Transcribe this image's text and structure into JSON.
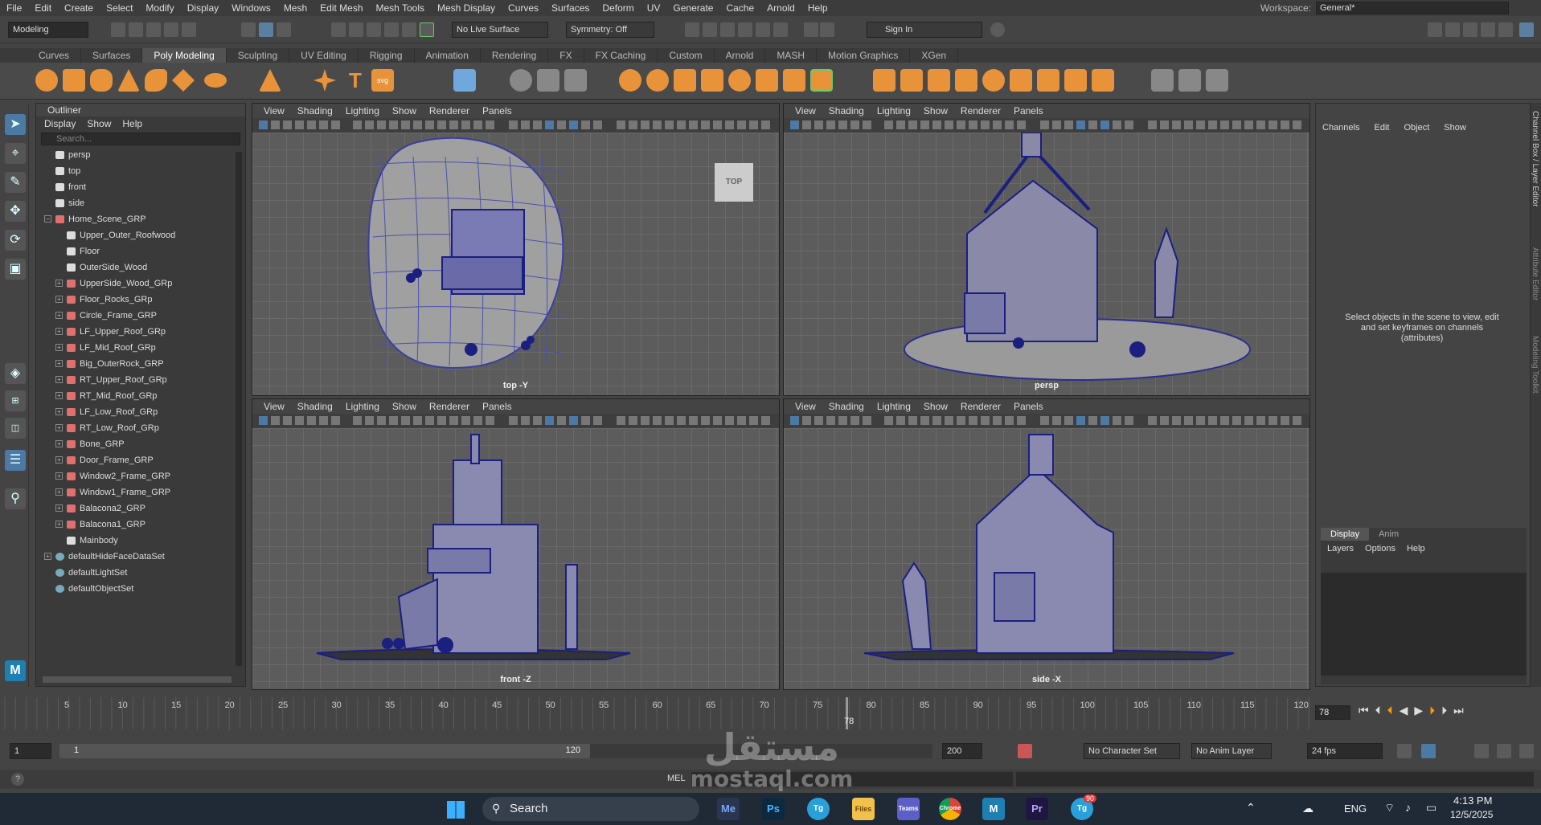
{
  "menubar": [
    "File",
    "Edit",
    "Create",
    "Select",
    "Modify",
    "Display",
    "Windows",
    "Mesh",
    "Edit Mesh",
    "Mesh Tools",
    "Mesh Display",
    "Curves",
    "Surfaces",
    "Deform",
    "UV",
    "Generate",
    "Cache",
    "Arnold",
    "Help"
  ],
  "workspace": {
    "label": "Workspace:",
    "value": "General*"
  },
  "status": {
    "mode": "Modeling",
    "live_surface": "No Live Surface",
    "symmetry": "Symmetry: Off",
    "sign_in": "Sign In"
  },
  "shelf_tabs": [
    "Curves",
    "Surfaces",
    "Poly Modeling",
    "Sculpting",
    "UV Editing",
    "Rigging",
    "Animation",
    "Rendering",
    "FX",
    "FX Caching",
    "Custom",
    "Arnold",
    "MASH",
    "Motion Graphics",
    "XGen"
  ],
  "outliner": {
    "title": "Outliner",
    "menu": [
      "Display",
      "Show",
      "Help"
    ],
    "search_placeholder": "Search...",
    "items": [
      {
        "label": "persp",
        "indent": 0,
        "icon": "camera-icon",
        "expander": ""
      },
      {
        "label": "top",
        "indent": 0,
        "icon": "camera-icon",
        "expander": ""
      },
      {
        "label": "front",
        "indent": 0,
        "icon": "camera-icon",
        "expander": ""
      },
      {
        "label": "side",
        "indent": 0,
        "icon": "camera-icon",
        "expander": ""
      },
      {
        "label": "Home_Scene_GRP",
        "indent": 0,
        "icon": "group-icon",
        "expander": "−"
      },
      {
        "label": "Upper_Outer_Roofwood",
        "indent": 1,
        "icon": "mesh-icon",
        "expander": ""
      },
      {
        "label": "Floor",
        "indent": 1,
        "icon": "mesh-icon",
        "expander": ""
      },
      {
        "label": "OuterSide_Wood",
        "indent": 1,
        "icon": "mesh-icon",
        "expander": ""
      },
      {
        "label": "UpperSide_Wood_GRp",
        "indent": 1,
        "icon": "group-icon",
        "expander": "+"
      },
      {
        "label": "Floor_Rocks_GRp",
        "indent": 1,
        "icon": "group-icon",
        "expander": "+"
      },
      {
        "label": "Circle_Frame_GRP",
        "indent": 1,
        "icon": "group-icon",
        "expander": "+"
      },
      {
        "label": "LF_Upper_Roof_GRp",
        "indent": 1,
        "icon": "group-icon",
        "expander": "+"
      },
      {
        "label": "LF_Mid_Roof_GRp",
        "indent": 1,
        "icon": "group-icon",
        "expander": "+"
      },
      {
        "label": "Big_OuterRock_GRP",
        "indent": 1,
        "icon": "group-icon",
        "expander": "+"
      },
      {
        "label": "RT_Upper_Roof_GRp",
        "indent": 1,
        "icon": "group-icon",
        "expander": "+"
      },
      {
        "label": "RT_Mid_Roof_GRp",
        "indent": 1,
        "icon": "group-icon",
        "expander": "+"
      },
      {
        "label": "LF_Low_Roof_GRp",
        "indent": 1,
        "icon": "group-icon",
        "expander": "+"
      },
      {
        "label": "RT_Low_Roof_GRp",
        "indent": 1,
        "icon": "group-icon",
        "expander": "+"
      },
      {
        "label": "Bone_GRP",
        "indent": 1,
        "icon": "group-icon",
        "expander": "+"
      },
      {
        "label": "Door_Frame_GRP",
        "indent": 1,
        "icon": "group-icon",
        "expander": "+"
      },
      {
        "label": "Window2_Frame_GRP",
        "indent": 1,
        "icon": "group-icon",
        "expander": "+"
      },
      {
        "label": "Window1_Frame_GRP",
        "indent": 1,
        "icon": "group-icon",
        "expander": "+"
      },
      {
        "label": "Balacona2_GRP",
        "indent": 1,
        "icon": "group-icon",
        "expander": "+"
      },
      {
        "label": "Balacona1_GRP",
        "indent": 1,
        "icon": "group-icon",
        "expander": "+"
      },
      {
        "label": "Mainbody",
        "indent": 1,
        "icon": "mesh-icon",
        "expander": ""
      },
      {
        "label": "defaultHideFaceDataSet",
        "indent": 0,
        "icon": "set-icon",
        "expander": "+"
      },
      {
        "label": "defaultLightSet",
        "indent": 0,
        "icon": "set-icon",
        "expander": ""
      },
      {
        "label": "defaultObjectSet",
        "indent": 0,
        "icon": "set-icon",
        "expander": ""
      }
    ]
  },
  "viewport_menu": [
    "View",
    "Shading",
    "Lighting",
    "Show",
    "Renderer",
    "Panels"
  ],
  "viewports": {
    "top": "top -Y",
    "persp": "persp",
    "front": "front -Z",
    "side": "side -X",
    "viewcube": "TOP"
  },
  "channel_box": {
    "menu": [
      "Channels",
      "Edit",
      "Object",
      "Show"
    ],
    "message": "Select objects in the scene to view, edit and set keyframes on channels (attributes)"
  },
  "layer_editor": {
    "tabs": [
      "Display",
      "Anim"
    ],
    "menu": [
      "Layers",
      "Options",
      "Help"
    ]
  },
  "side_tabs": [
    "Channel Box / Layer Editor",
    "Attribute Editor",
    "Modeling Toolkit"
  ],
  "timeline": {
    "ticks": [
      "5",
      "10",
      "15",
      "20",
      "25",
      "30",
      "35",
      "40",
      "45",
      "50",
      "55",
      "60",
      "65",
      "70",
      "75",
      "80",
      "85",
      "90",
      "95",
      "100",
      "105",
      "110",
      "115",
      "120"
    ],
    "current_frame": "78",
    "current_frame_field": "78"
  },
  "range": {
    "start": "1",
    "inner_start": "1",
    "inner_end": "120",
    "end": "200",
    "char_set": "No Character Set",
    "anim_layer": "No Anim Layer",
    "fps": "24 fps"
  },
  "cmdline": {
    "label": "MEL"
  },
  "watermark": {
    "arabic": "مستقل",
    "latin": "mostaql.com"
  },
  "taskbar": {
    "search": "Search",
    "apps": [
      "Me",
      "Ps",
      "Tg",
      "Files",
      "Teams",
      "Chrome",
      "M",
      "Pr",
      "Tg"
    ],
    "badge": "90",
    "lang": "ENG",
    "time": "4:13 PM",
    "date": "12/5/2025"
  }
}
